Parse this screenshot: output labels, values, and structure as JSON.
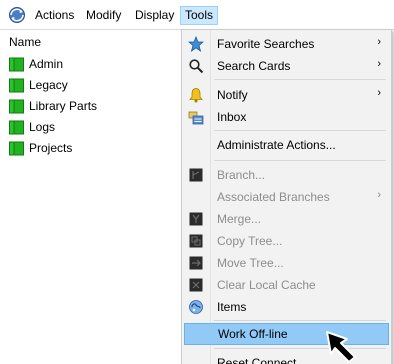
{
  "menubar": {
    "items": [
      {
        "label": "Actions"
      },
      {
        "label": "Modify"
      },
      {
        "label": "Display"
      },
      {
        "label": "Tools"
      }
    ]
  },
  "tree": {
    "header": "Name",
    "items": [
      {
        "label": "Admin",
        "icon": "folder-icon"
      },
      {
        "label": "Legacy",
        "icon": "folder-icon"
      },
      {
        "label": "Library Parts",
        "icon": "folder-icon"
      },
      {
        "label": "Logs",
        "icon": "folder-icon"
      },
      {
        "label": "Projects",
        "icon": "folder-icon"
      }
    ]
  },
  "tools_menu": {
    "items": [
      {
        "label": "Favorite Searches",
        "icon": "star-icon",
        "submenu": "›"
      },
      {
        "label": "Search Cards",
        "icon": "magnifier-icon",
        "submenu": "›"
      },
      {
        "label": "Notify",
        "icon": "bell-icon",
        "submenu": "›"
      },
      {
        "label": "Inbox",
        "icon": "inbox-icon"
      },
      {
        "label": "Administrate Actions..."
      },
      {
        "label": "Branch...",
        "icon": "branch-icon",
        "disabled": true
      },
      {
        "label": "Associated Branches",
        "disabled": true,
        "submenu": "›"
      },
      {
        "label": "Merge...",
        "icon": "merge-icon",
        "disabled": true
      },
      {
        "label": "Copy Tree...",
        "icon": "copy-tree-icon",
        "disabled": true
      },
      {
        "label": "Move Tree...",
        "icon": "move-tree-icon",
        "disabled": true
      },
      {
        "label": "Clear Local Cache",
        "icon": "clear-cache-icon",
        "disabled": true
      },
      {
        "label": "Items",
        "icon": "items-icon"
      },
      {
        "label": "Work Off-line",
        "highlighted": true
      },
      {
        "label": "Reset Connect..."
      }
    ]
  },
  "colors": {
    "menu_background": "#f2f2f2",
    "highlight": "#91c9f7",
    "tools_active": "#cce8ff",
    "folder_green": "#1fb31f",
    "disabled_text": "#8d8d8d"
  }
}
